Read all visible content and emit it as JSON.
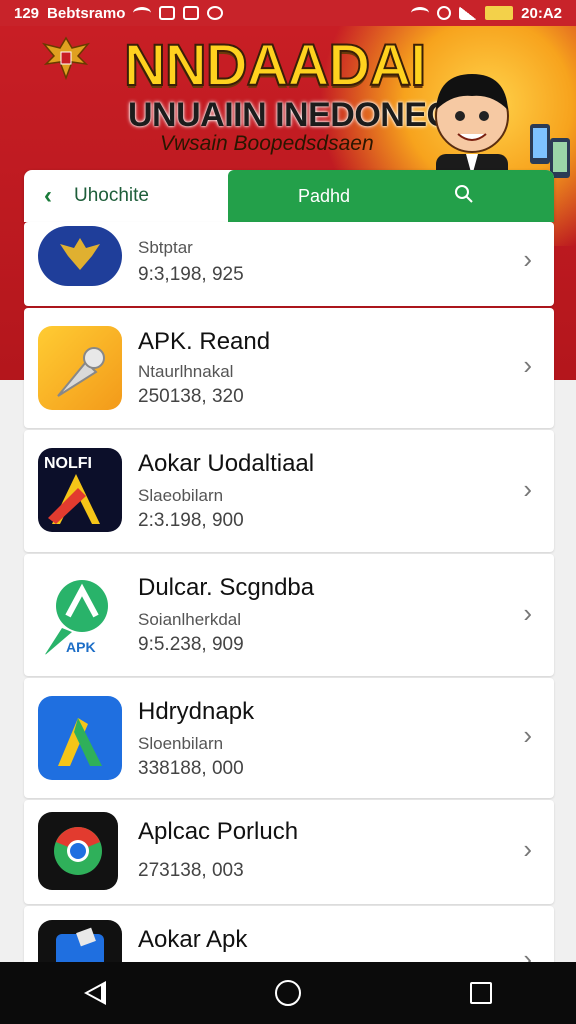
{
  "status_bar": {
    "time": "129",
    "carrier": "Bebtsramo",
    "clock": "20:A2"
  },
  "banner": {
    "title": "NNDAADAI",
    "subtitle": "UNUAIIN INEDONEGA",
    "tagline": "Vwsain Boopedsdsaen",
    "colors": {
      "red": "#c81e25",
      "gold": "#ffd21f"
    }
  },
  "tabs": {
    "back_label": "Uhochite",
    "active_label": "Padhd"
  },
  "apps": [
    {
      "title": "",
      "sub": "Sbtptar",
      "num": "9:3,198, 925",
      "icon": "garuda-icon"
    },
    {
      "title": "APK. Reand",
      "sub": "Ntaurlhnakal",
      "num": "250138, 320",
      "icon": "pin-icon"
    },
    {
      "title": "Aokar Uodaltiaal",
      "sub": "Slaeobilarn",
      "num": "2:3.198, 900",
      "icon": "nolfi-a-icon"
    },
    {
      "title": "Dulcar. Scgndba",
      "sub": "Soianlherkdal",
      "num": "9:5.238, 909",
      "icon": "apk-logo-icon"
    },
    {
      "title": "Hdrydnapk",
      "sub": "Sloenbilarn",
      "num": "338188, 000",
      "icon": "triangle-a-icon"
    },
    {
      "title": "Aplcac Porluch",
      "sub": "",
      "num": "273138, 003",
      "icon": "chrome-like-icon"
    },
    {
      "title": "Aokar Apk",
      "sub": "",
      "num": "",
      "icon": "shield-icon"
    }
  ]
}
